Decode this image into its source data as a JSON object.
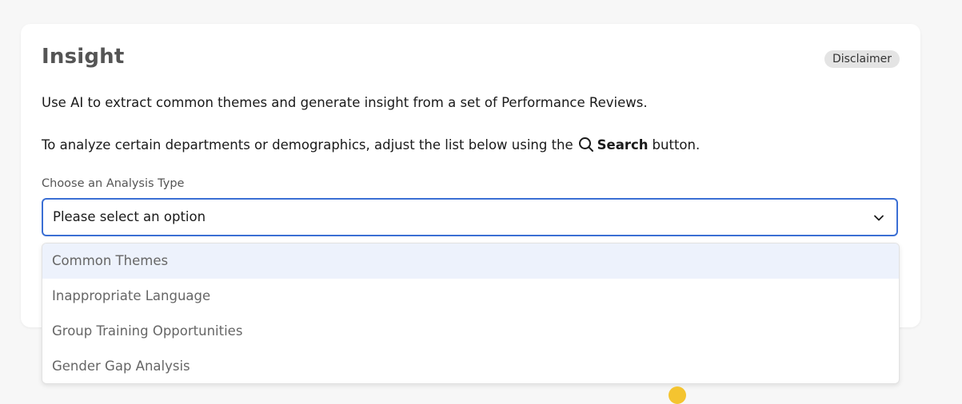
{
  "card": {
    "title": "Insight",
    "disclaimer_label": "Disclaimer",
    "description_1": "Use AI to extract common themes and generate insight from a set of Performance Reviews.",
    "description_2_prefix": "To analyze certain departments or demographics, adjust the list below using the",
    "description_2_bold": "Search",
    "description_2_suffix": "button."
  },
  "analysis_select": {
    "label": "Choose an Analysis Type",
    "selected_value": "Please select an option",
    "options": [
      {
        "label": "Common Themes"
      },
      {
        "label": "Inappropriate Language"
      },
      {
        "label": "Group Training Opportunities"
      },
      {
        "label": "Gender Gap Analysis"
      }
    ],
    "highlighted_index": 0
  },
  "colors": {
    "accent": "#3b6fd4",
    "highlight": "#edf2fc",
    "badge_bg": "#e4e4e4"
  }
}
